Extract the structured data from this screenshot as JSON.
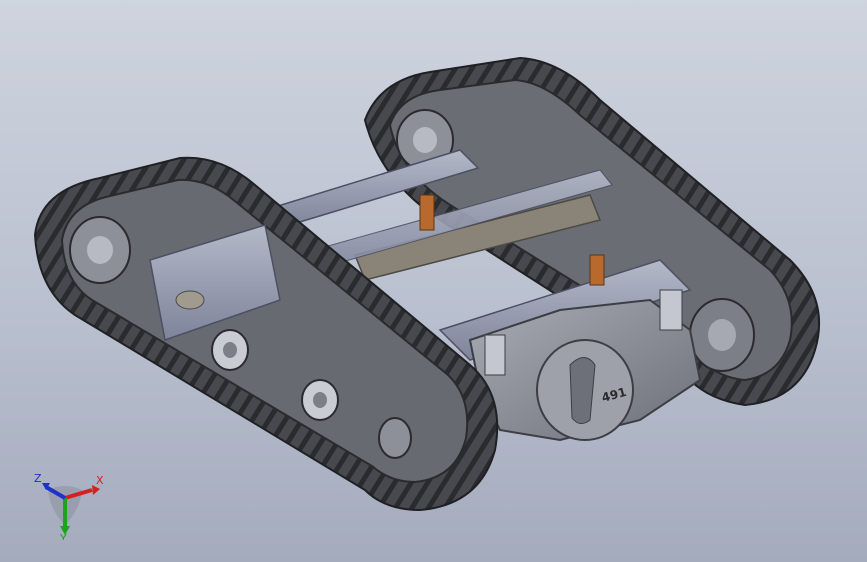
{
  "viewport": {
    "background_top": "#cfd4de",
    "background_bottom": "#a4abbd"
  },
  "model": {
    "track_color": "#4a4c50",
    "track_dark": "#2b2c2f",
    "frame_color": "#9aa0b4",
    "housing_color": "#8c8f98",
    "accent_color": "#b8692e",
    "housing_marking": "491"
  },
  "triad": {
    "x_label": "X",
    "y_label": "Y",
    "z_label": "Z",
    "x_color": "#d42020",
    "y_color": "#1fa21f",
    "z_color": "#2030c8"
  }
}
